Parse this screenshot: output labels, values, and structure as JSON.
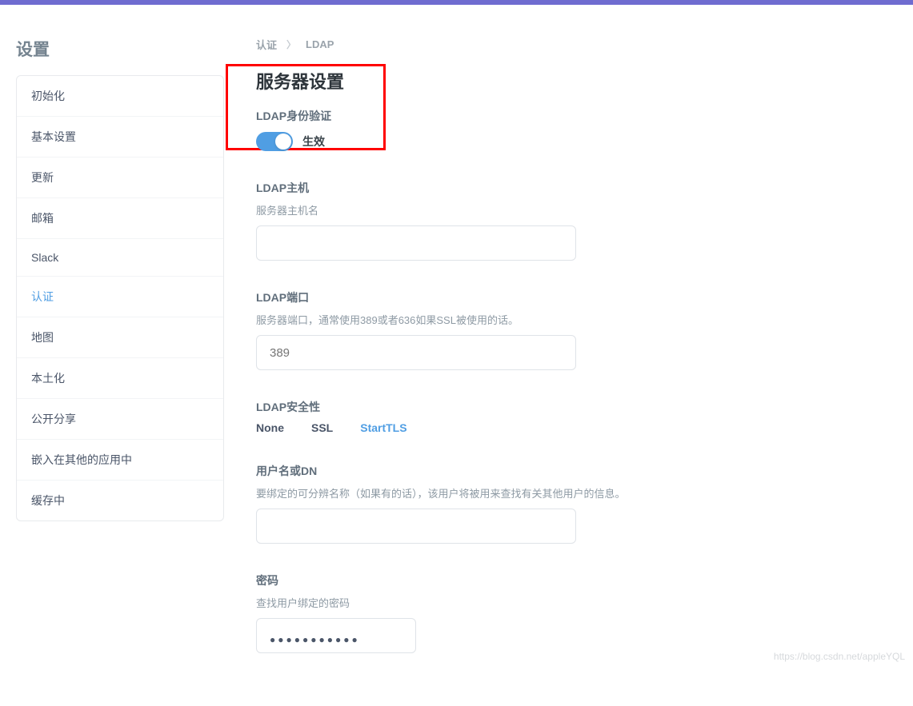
{
  "page_title": "设置",
  "sidebar": {
    "items": [
      {
        "label": "初始化",
        "active": false
      },
      {
        "label": "基本设置",
        "active": false
      },
      {
        "label": "更新",
        "active": false
      },
      {
        "label": "邮箱",
        "active": false
      },
      {
        "label": "Slack",
        "active": false
      },
      {
        "label": "认证",
        "active": true
      },
      {
        "label": "地图",
        "active": false
      },
      {
        "label": "本土化",
        "active": false
      },
      {
        "label": "公开分享",
        "active": false
      },
      {
        "label": "嵌入在其他的应用中",
        "active": false
      },
      {
        "label": "缓存中",
        "active": false
      }
    ]
  },
  "breadcrumb": {
    "root": "认证",
    "current": "LDAP"
  },
  "heading": "服务器设置",
  "ldap_auth": {
    "label": "LDAP身份验证",
    "toggle_on_label": "生效",
    "enabled": true
  },
  "ldap_host": {
    "label": "LDAP主机",
    "desc": "服务器主机名",
    "value": ""
  },
  "ldap_port": {
    "label": "LDAP端口",
    "desc": "服务器端口，通常使用389或者636如果SSL被使用的话。",
    "placeholder": "389"
  },
  "ldap_security": {
    "label": "LDAP安全性",
    "options": [
      "None",
      "SSL",
      "StartTLS"
    ],
    "selected": "StartTLS"
  },
  "ldap_userdn": {
    "label": "用户名或DN",
    "desc": "要绑定的可分辨名称（如果有的话），该用户将被用来查找有关其他用户的信息。",
    "value": ""
  },
  "ldap_password": {
    "label": "密码",
    "desc": "查找用户绑定的密码",
    "value": "●●●●●●●●●●●"
  },
  "watermark": "https://blog.csdn.net/appleYQL"
}
